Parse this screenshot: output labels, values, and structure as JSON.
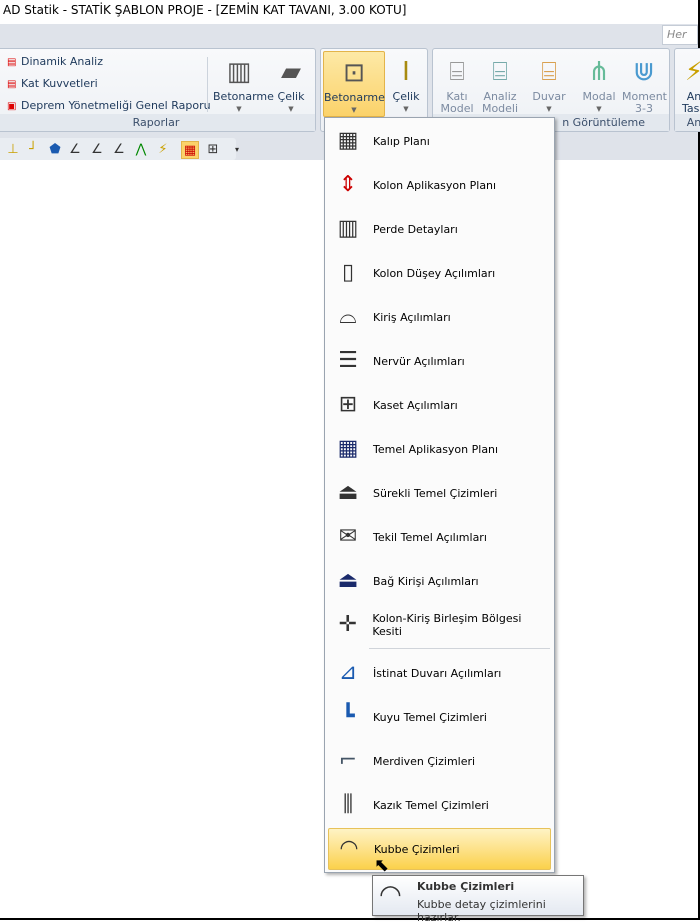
{
  "window": {
    "title": "AD Statik - STATİK ŞABLON PROJE - [ZEMİN KAT TAVANI,  3.00 KOTU]",
    "search_placeholder": "Her"
  },
  "ribbon": {
    "raporlar": {
      "label": "Raporlar",
      "items": [
        "Dinamik Analiz",
        "Kat Kuvvetleri",
        "Deprem Yönetmeliği Genel Raporu"
      ],
      "big": [
        "Betonarme",
        "Çelik"
      ]
    },
    "cizim": {
      "big": [
        "Betonarme",
        "Çelik"
      ]
    },
    "goruntuleme": {
      "label": "n Görüntüleme",
      "big": [
        "Katı Model",
        "Analiz Modeli",
        "Duvar",
        "Modal",
        "Moment 3-3"
      ]
    },
    "last": {
      "label": "An",
      "big": "An Tasa"
    }
  },
  "menu": {
    "items": [
      "Kalıp Planı",
      "Kolon Aplikasyon Planı",
      "Perde Detayları",
      "Kolon Düşey Açılımları",
      "Kiriş Açılımları",
      "Nervür Açılımları",
      "Kaset Açılımları",
      "Temel Aplikasyon Planı",
      "Sürekli Temel Çizimleri",
      "Tekil Temel Açılımları",
      "Bağ Kirişi Açılımları",
      "Kolon-Kiriş Birleşim Bölgesi Kesiti",
      "İstinat Duvarı Açılımları",
      "Kuyu Temel Çizimleri",
      "Merdiven Çizimleri",
      "Kazık Temel Çizimleri",
      "Kubbe Çizimleri"
    ],
    "highlighted": "Kubbe Çizimleri"
  },
  "tooltip": {
    "title": "Kubbe Çizimleri",
    "description": "Kubbe detay çizimlerini hazırlar."
  }
}
